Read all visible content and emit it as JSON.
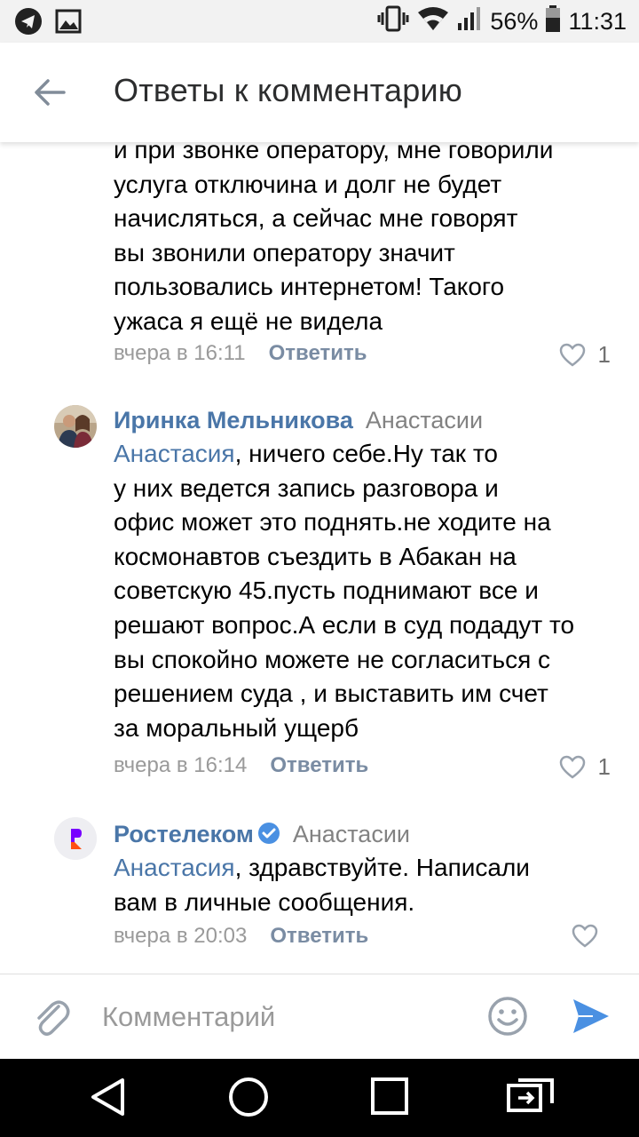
{
  "status_bar": {
    "battery": "56%",
    "time": "11:31",
    "icons": [
      "telegram-icon",
      "image-icon",
      "vibrate-icon",
      "wifi-icon",
      "signal-icon",
      "battery-icon"
    ]
  },
  "header": {
    "title": "Ответы к комментарию",
    "back_icon": "arrow-left-icon"
  },
  "comments": [
    {
      "lines": [
        "и при звонке оператору, мне говорили",
        "услуга отключина и долг не будет",
        "начисляться, а сейчас мне говорят",
        "вы звонили оператору значит",
        "пользовались интернетом! Такого",
        "ужаса я ещё не видела"
      ],
      "time": "вчера в 16:11",
      "reply_label": "Ответить",
      "likes": "1"
    },
    {
      "author": "Иринка Мельникова",
      "reply_to": "Анастасии",
      "mention": "Анастасия",
      "first_line_rest": ", ничего себе.Ну так то",
      "lines": [
        "у них ведется запись разговора и",
        "офис может это поднять.не ходите на",
        "космонавтов съездить в Абакан на",
        "советскую 45.пусть поднимают все и",
        "решают вопрос.А если в суд подадут то",
        "вы спокойно можете не согласиться с",
        "решением суда , и выставить им счет",
        "за моральный ущерб"
      ],
      "time": "вчера в 16:14",
      "reply_label": "Ответить",
      "likes": "1"
    },
    {
      "author": "Ростелеком",
      "reply_to": "Анастасии",
      "mention": "Анастасия",
      "first_line_rest": ", здравствуйте. Написали",
      "lines": [
        "вам в личные сообщения."
      ],
      "time": "вчера в 20:03",
      "reply_label": "Ответить",
      "likes": ""
    }
  ],
  "composer": {
    "placeholder": "Комментарий"
  },
  "colors": {
    "link": "#4a76a8",
    "send": "#4a90e2",
    "rostelecom_orange": "#ff4f12",
    "rostelecom_purple": "#7700ff"
  }
}
